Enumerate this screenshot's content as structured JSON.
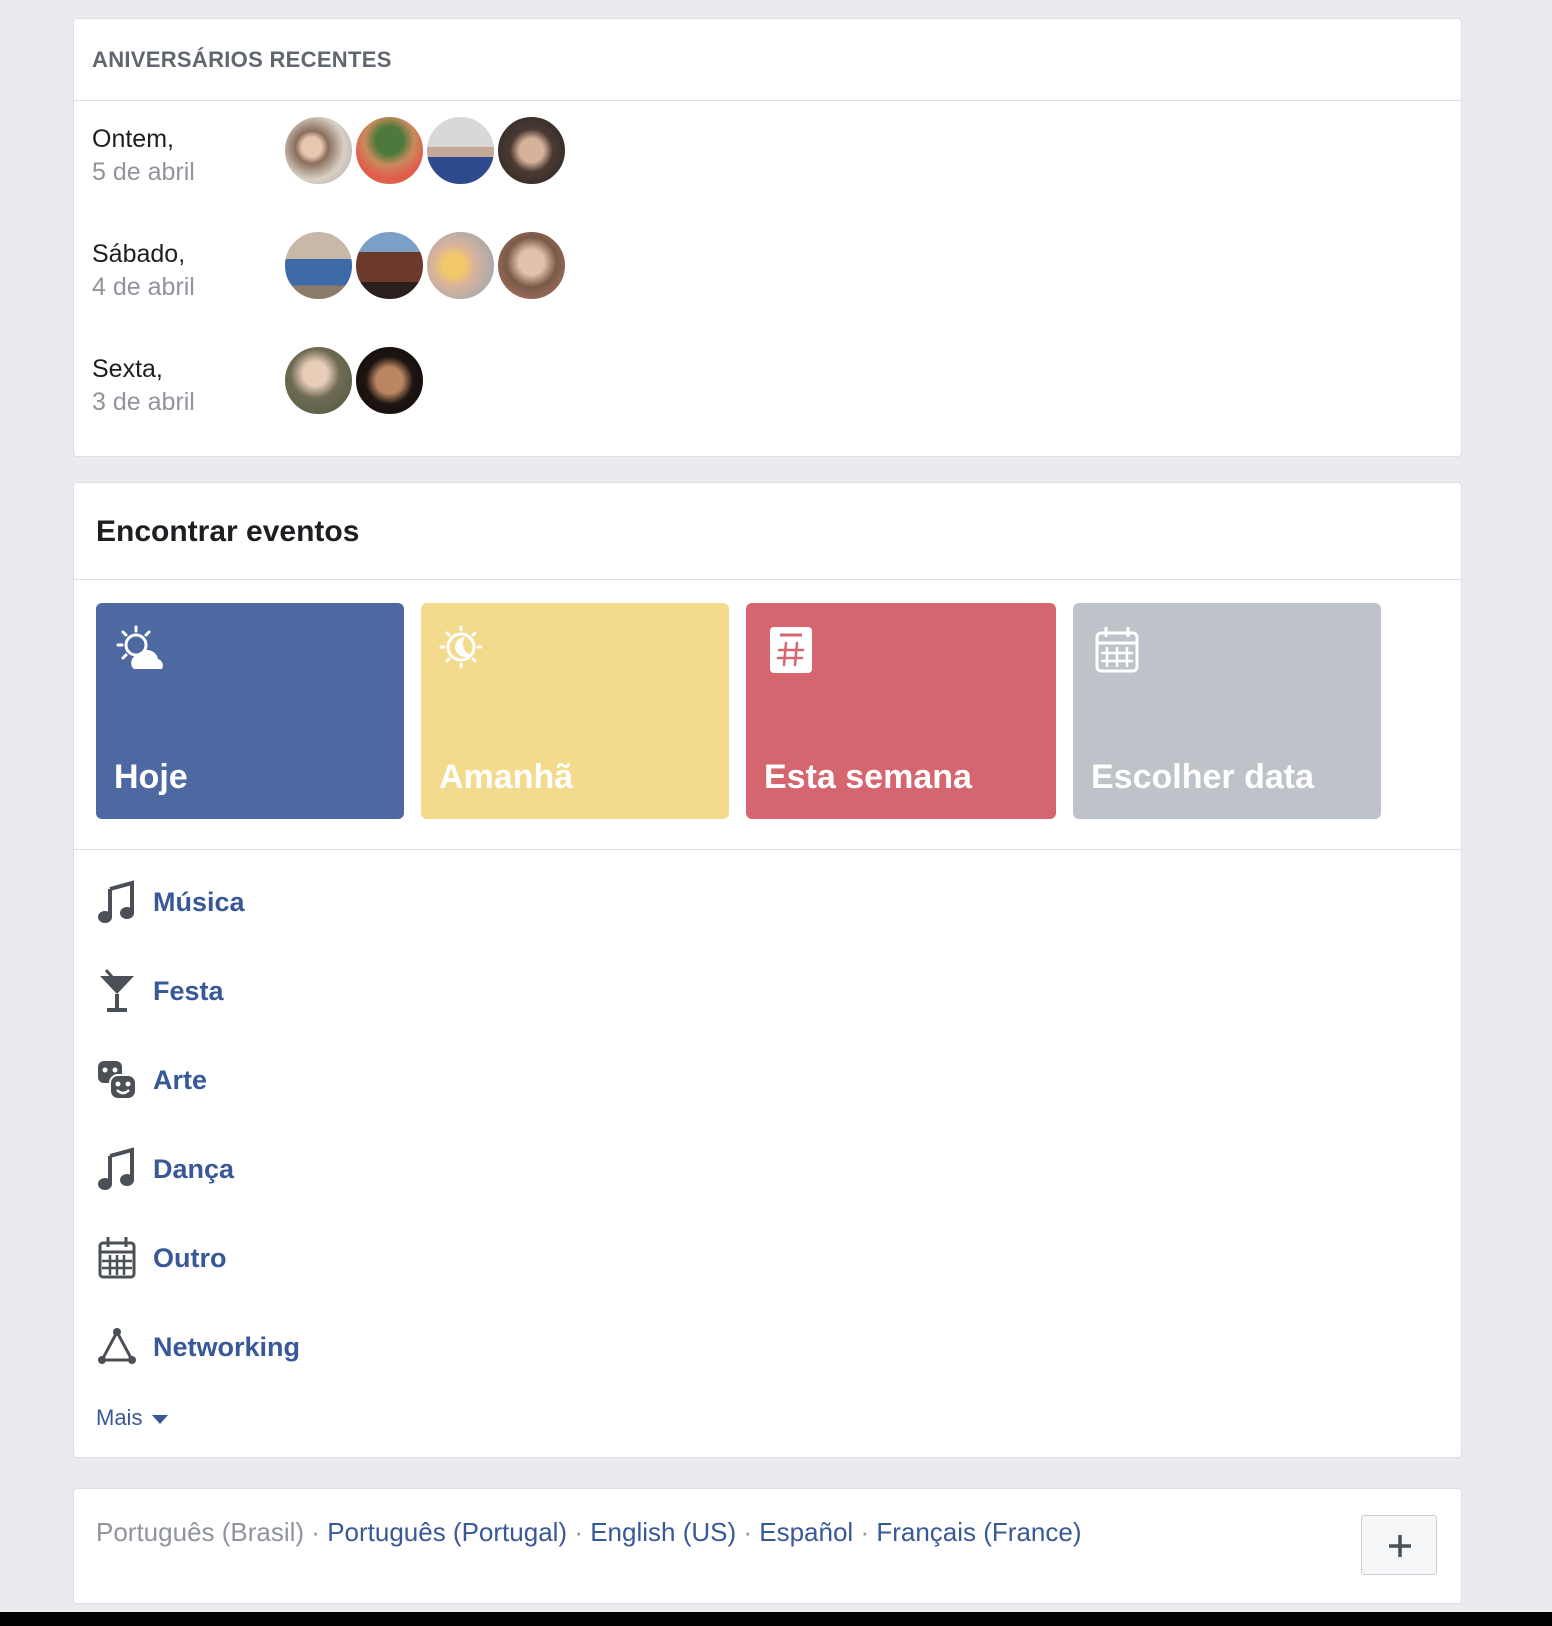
{
  "birthdays": {
    "title": "ANIVERSÁRIOS RECENTES",
    "groups": [
      {
        "day": "Ontem,",
        "date": "5 de abril",
        "avatars": 4
      },
      {
        "day": "Sábado,",
        "date": "4 de abril",
        "avatars": 4
      },
      {
        "day": "Sexta,",
        "date": "3 de abril",
        "avatars": 2
      }
    ]
  },
  "events": {
    "title": "Encontrar eventos",
    "tiles": [
      {
        "label": "Hoje",
        "color": "#4e69a2",
        "icon": "sun-cloud-icon"
      },
      {
        "label": "Amanhã",
        "color": "#f3da8c",
        "icon": "moon-sun-icon"
      },
      {
        "label": "Esta semana",
        "color": "#d5666f",
        "icon": "hashtag-calendar-icon"
      },
      {
        "label": "Escolher data",
        "color": "#bec3c9",
        "icon": "calendar-icon"
      }
    ],
    "categories": [
      {
        "label": "Música",
        "icon": "music-note-icon"
      },
      {
        "label": "Festa",
        "icon": "cocktail-icon"
      },
      {
        "label": "Arte",
        "icon": "theater-masks-icon"
      },
      {
        "label": "Dança",
        "icon": "music-note-icon"
      },
      {
        "label": "Outro",
        "icon": "calendar-icon"
      },
      {
        "label": "Networking",
        "icon": "network-icon"
      }
    ],
    "more_label": "Mais"
  },
  "footer": {
    "current_language": "Português (Brasil)",
    "languages": [
      "Português (Portugal)",
      "English (US)",
      "Español",
      "Français (France)"
    ],
    "separator": " · ",
    "add_button": "+"
  }
}
